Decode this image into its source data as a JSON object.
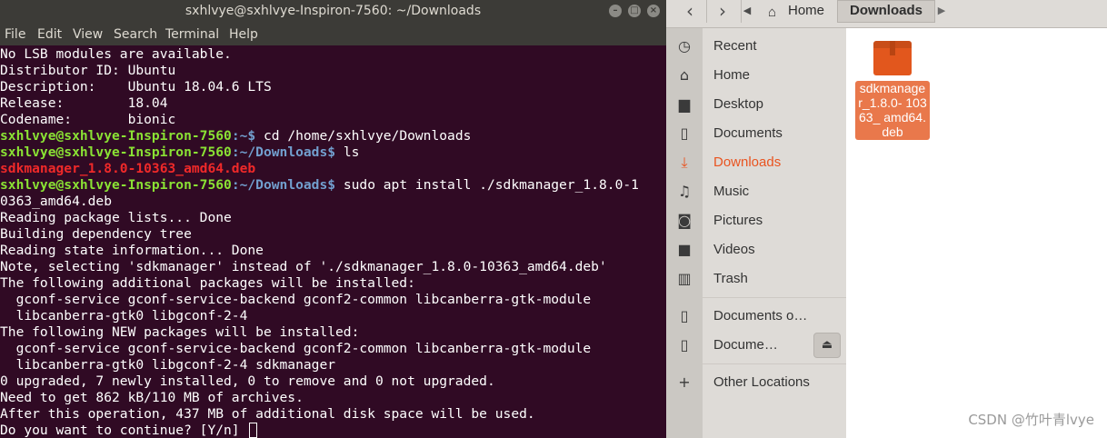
{
  "terminal": {
    "title": "sxhlvye@sxhlvye-Inspiron-7560: ~/Downloads",
    "menu": [
      "File",
      "Edit",
      "View",
      "Search",
      "Terminal",
      "Help"
    ],
    "prompt_user": "sxhlvye@sxhlvye-Inspiron-7560",
    "lines": [
      "No LSB modules are available.",
      "Distributor ID: Ubuntu",
      "Description:    Ubuntu 18.04.6 LTS",
      "Release:        18.04",
      "Codename:       bionic"
    ],
    "cmd1": {
      "path": ":~$",
      "command": " cd /home/sxhlvye/Downloads"
    },
    "cmd2": {
      "path": ":~/Downloads$",
      "command": " ls"
    },
    "ls_output": "sdkmanager_1.8.0-10363_amd64.deb",
    "cmd3": {
      "path": ":~/Downloads$",
      "command": " sudo apt install ./sdkmanager_1.8.0-1"
    },
    "wrap": "0363_amd64.deb",
    "output": [
      "Reading package lists... Done",
      "Building dependency tree",
      "Reading state information... Done",
      "Note, selecting 'sdkmanager' instead of './sdkmanager_1.8.0-10363_amd64.deb'",
      "The following additional packages will be installed:",
      "  gconf-service gconf-service-backend gconf2-common libcanberra-gtk-module",
      "  libcanberra-gtk0 libgconf-2-4",
      "The following NEW packages will be installed:",
      "  gconf-service gconf-service-backend gconf2-common libcanberra-gtk-module",
      "  libcanberra-gtk0 libgconf-2-4 sdkmanager",
      "0 upgraded, 7 newly installed, 0 to remove and 0 not upgraded.",
      "Need to get 862 kB/110 MB of archives.",
      "After this operation, 437 MB of additional disk space will be used.",
      "Do you want to continue? [Y/n] "
    ],
    "colors": {
      "background": "#300a24",
      "prompt_user": "#8ae234",
      "prompt_path": "#729fcf",
      "deb_file": "#ef2929"
    }
  },
  "files": {
    "breadcrumb": {
      "home": "Home",
      "current": "Downloads"
    },
    "sidebar": [
      {
        "label": "Recent",
        "icon": "clock-icon",
        "glyph": "◷"
      },
      {
        "label": "Home",
        "icon": "home-icon",
        "glyph": "⌂"
      },
      {
        "label": "Desktop",
        "icon": "folder-icon",
        "glyph": "▆"
      },
      {
        "label": "Documents",
        "icon": "document-icon",
        "glyph": "▯"
      },
      {
        "label": "Downloads",
        "icon": "download-icon",
        "glyph": "⤓"
      },
      {
        "label": "Music",
        "icon": "music-icon",
        "glyph": "♫"
      },
      {
        "label": "Pictures",
        "icon": "camera-icon",
        "glyph": "◙"
      },
      {
        "label": "Videos",
        "icon": "video-icon",
        "glyph": "■"
      },
      {
        "label": "Trash",
        "icon": "trash-icon",
        "glyph": "▥"
      }
    ],
    "devices": [
      {
        "label": "Documents o…",
        "icon": "drive-icon",
        "glyph": "▯"
      },
      {
        "label": "Docume…",
        "icon": "drive-icon",
        "glyph": "▯"
      }
    ],
    "other_locations": {
      "label": "Other Locations",
      "glyph": "+"
    },
    "file_item": {
      "name": "sdkmanager_1.8.0-10363_amd64.deb",
      "display": "sdkmanage r_1.8.0- 10363_ amd64.deb"
    },
    "accent_color": "#e95420"
  },
  "watermark": "CSDN @竹叶青lvye"
}
